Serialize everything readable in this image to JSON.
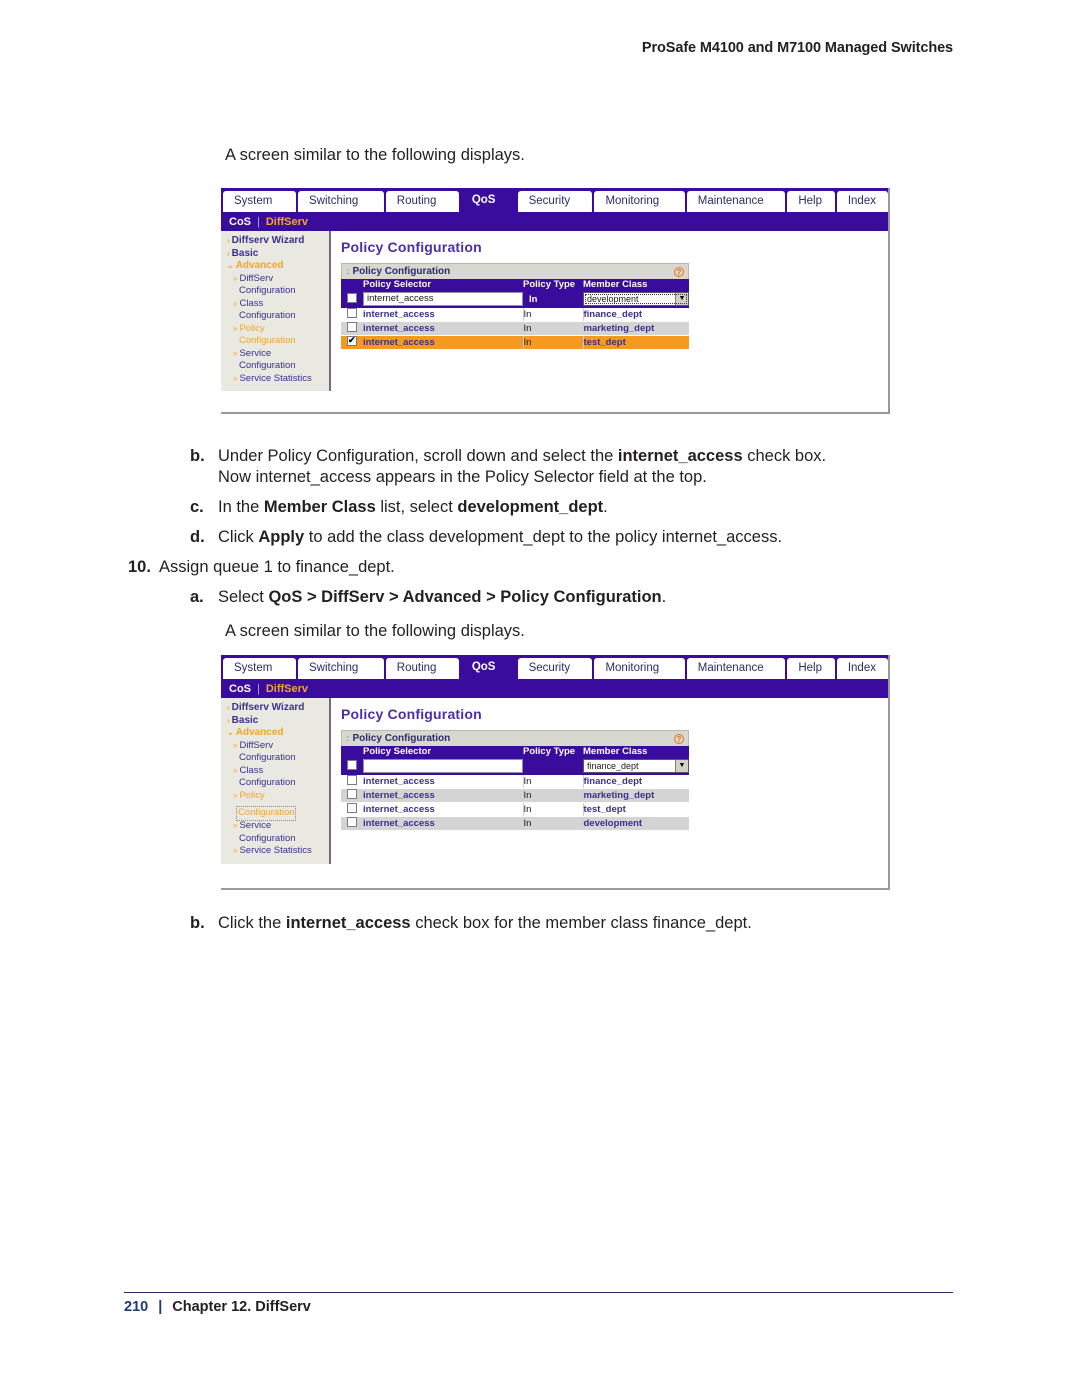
{
  "document": {
    "header": "ProSafe M4100 and M7100 Managed Switches",
    "footer": {
      "page_number": "210",
      "separator": "|",
      "chapter": "Chapter 12. DiffServ"
    }
  },
  "intro1": "A screen similar to the following displays.",
  "intro2": "A screen similar to the following displays.",
  "steps": {
    "b1": {
      "label": "b.",
      "line1_pre": "Under Policy Configuration, scroll down and select the ",
      "line1_bold": "internet_access",
      "line1_post": " check box.",
      "line2": "Now internet_access appears in the Policy Selector field at the top."
    },
    "c1": {
      "label": "c.",
      "pre": "In the ",
      "bold1": "Member Class",
      "mid": " list, select ",
      "bold2": "development_dept",
      "post": "."
    },
    "d1": {
      "label": "d.",
      "pre": "Click ",
      "bold": "Apply",
      "post": " to add the class development_dept to the policy internet_access."
    },
    "s10": {
      "label": "10.",
      "text": "Assign queue 1 to finance_dept."
    },
    "a10": {
      "label": "a.",
      "pre": "Select ",
      "bold": "QoS > DiffServ > Advanced > Policy Configuration",
      "post": "."
    },
    "b2": {
      "label": "b.",
      "pre": "Click the ",
      "bold": "internet_access",
      "post": " check box for the member class finance_dept."
    }
  },
  "ui": {
    "tabs": [
      "System",
      "Switching",
      "Routing",
      "QoS",
      "Security",
      "Monitoring",
      "Maintenance",
      "Help",
      "Index"
    ],
    "active_tab": "QoS",
    "subnav": {
      "items": [
        "CoS",
        "DiffServ"
      ],
      "separator": "|",
      "active": "DiffServ"
    },
    "sidebar": [
      {
        "label": "Diffserv Wizard",
        "level": "top"
      },
      {
        "label": "Basic",
        "level": "top"
      },
      {
        "label": "Advanced",
        "level": "top",
        "state": "expanded"
      },
      {
        "label": "DiffServ",
        "level": "sub"
      },
      {
        "label": "Configuration",
        "level": "sub2"
      },
      {
        "label": "Class",
        "level": "sub"
      },
      {
        "label": "Configuration",
        "level": "sub2"
      },
      {
        "label": "Policy",
        "level": "sub"
      },
      {
        "label": "Configuration",
        "level": "sub2"
      },
      {
        "label": "Service",
        "level": "sub"
      },
      {
        "label": "Configuration",
        "level": "sub2"
      },
      {
        "label": "Service Statistics",
        "level": "sub"
      }
    ],
    "content_title": "Policy Configuration",
    "panel_title": "Policy Configuration",
    "help_icon_glyph": "?",
    "columns": [
      "Policy Selector",
      "Policy Type",
      "Member Class"
    ],
    "shot1": {
      "input_value": "internet_access",
      "input_policy_type": "In",
      "dropdown_value": "development",
      "dropdown_focused": true,
      "input_checked": false,
      "rows": [
        {
          "selector": "internet_access",
          "type": "In",
          "member": "finance_dept",
          "checked": false,
          "shade": "white"
        },
        {
          "selector": "internet_access",
          "type": "In",
          "member": "marketing_dept",
          "checked": false,
          "shade": "gray"
        },
        {
          "selector": "internet_access",
          "type": "In",
          "member": "test_dept",
          "checked": true,
          "shade": "hl"
        }
      ]
    },
    "shot2": {
      "input_value": "",
      "input_policy_type": "",
      "dropdown_value": "finance_dept",
      "dropdown_focused": false,
      "input_checked": false,
      "rows": [
        {
          "selector": "internet_access",
          "type": "In",
          "member": "finance_dept",
          "checked": false,
          "shade": "white"
        },
        {
          "selector": "internet_access",
          "type": "In",
          "member": "marketing_dept",
          "checked": false,
          "shade": "gray"
        },
        {
          "selector": "internet_access",
          "type": "In",
          "member": "test_dept",
          "checked": false,
          "shade": "white"
        },
        {
          "selector": "internet_access",
          "type": "In",
          "member": "development",
          "checked": false,
          "shade": "gray"
        }
      ]
    }
  },
  "colors": {
    "purple": "#3a0c9e",
    "orange": "#f5a623",
    "highlight": "#f59a1e",
    "link": "#3a2f8f"
  }
}
